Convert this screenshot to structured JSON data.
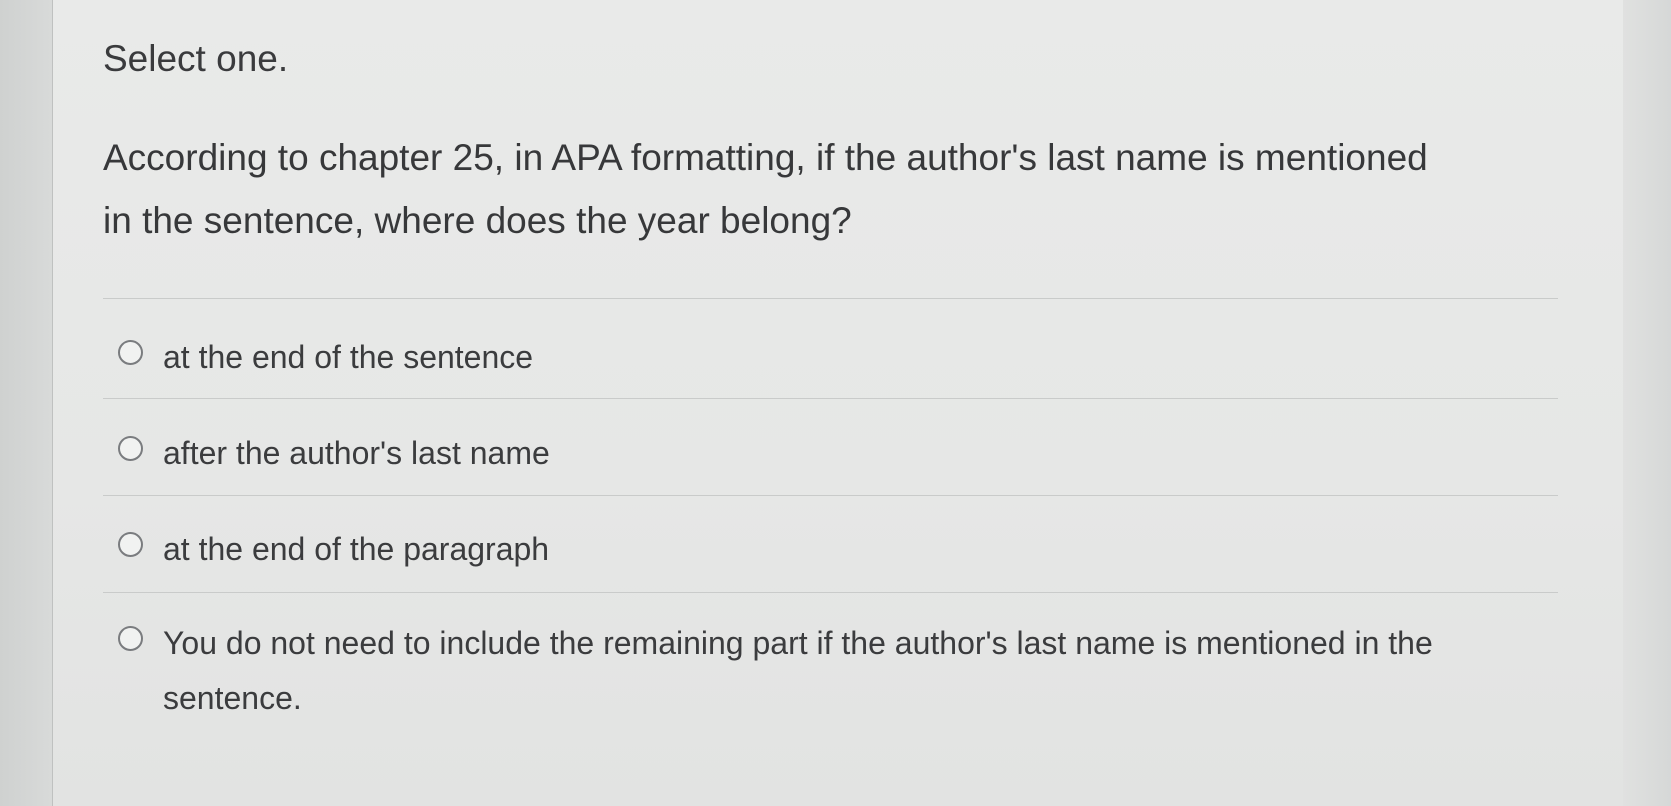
{
  "quiz": {
    "instruction": "Select one.",
    "question": "According to chapter 25, in APA formatting, if the author's last name is mentioned in the sentence, where does the year belong?",
    "options": [
      {
        "label": "at the end of the sentence",
        "selected": false
      },
      {
        "label": "after the author's last name",
        "selected": false
      },
      {
        "label": "at the end of the paragraph",
        "selected": false
      },
      {
        "label": "You do not need to include the remaining part if the author's last name is mentioned in the sentence.",
        "selected": false
      }
    ]
  }
}
